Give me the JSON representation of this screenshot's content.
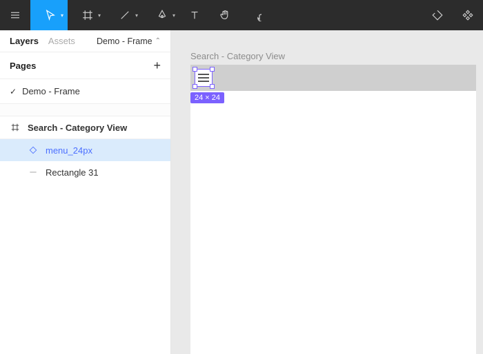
{
  "sidebar": {
    "tabs": {
      "layers": "Layers",
      "assets": "Assets"
    },
    "crumb": "Demo - Frame",
    "pages_label": "Pages",
    "page_name": "Demo - Frame",
    "frame_name": "Search - Category View",
    "layer_selected": "menu_24px",
    "layer_rect": "Rectangle 31"
  },
  "canvas": {
    "frame_title": "Search - Category View",
    "dimensions": "24 × 24"
  }
}
